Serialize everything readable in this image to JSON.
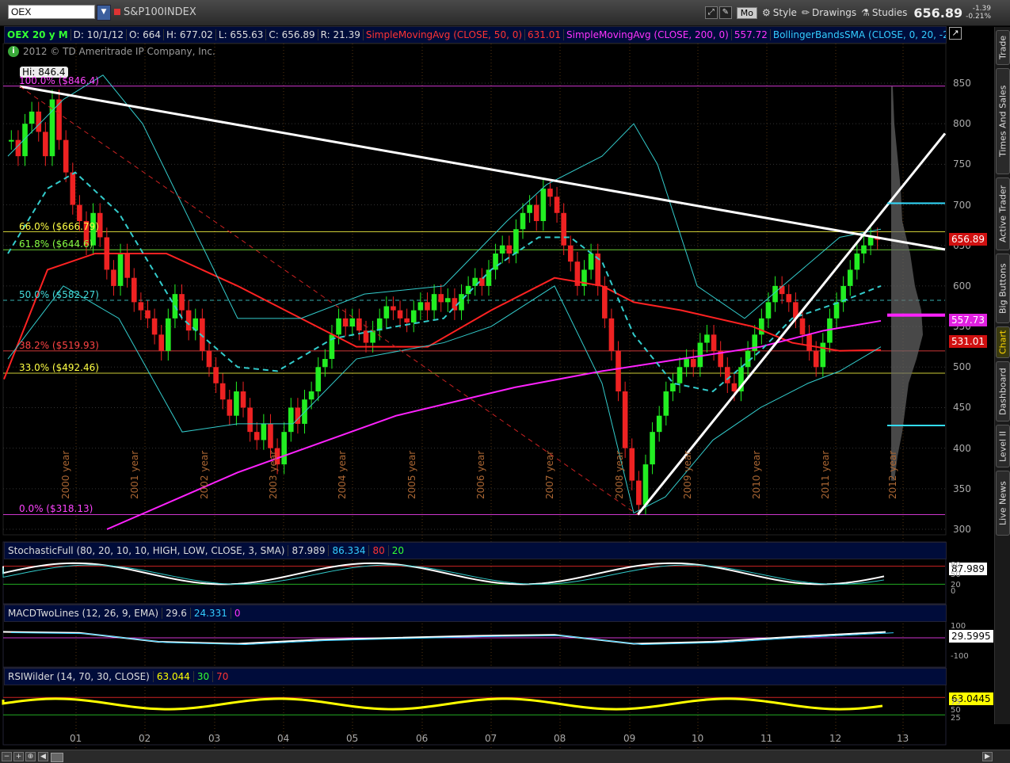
{
  "toolbar": {
    "symbol": "OEX",
    "symbol_name": "S&P100INDEX",
    "mode_label": "Mo",
    "style_label": "Style",
    "drawings_label": "Drawings",
    "studies_label": "Studies",
    "last_price": "656.89",
    "change": "-1.39",
    "change_pct": "-0.21%"
  },
  "legend": {
    "title": "OEX 20 y M",
    "date": "D: 10/1/12",
    "open": "O: 664",
    "high": "H: 677.02",
    "low": "L: 655.63",
    "close": "C: 656.89",
    "range": "R: 21.39",
    "sma50": "SimpleMovingAvg (CLOSE, 50, 0)",
    "sma50_val": "631.01",
    "sma200": "SimpleMovingAvg (CLOSE, 200, 0)",
    "sma200_val": "557.72",
    "bb": "BollingerBandsSMA (CLOSE, 0, 20, -2..."
  },
  "copyright": "2012 © TD Ameritrade IP Company, Inc.",
  "hi_label": "Hi: 846.4",
  "fib_labels": [
    {
      "text": "100.0%  ($846.4)",
      "price": 846.4,
      "color": "#ff44ff"
    },
    {
      "text": "66.0%  ($666.79)",
      "price": 666.79,
      "color": "#ffff44"
    },
    {
      "text": "61.8%  ($644.6)",
      "price": 644.6,
      "color": "#88ff44"
    },
    {
      "text": "50.0%  ($582.27)",
      "price": 582.27,
      "color": "#44dddd"
    },
    {
      "text": "38.2%  ($519.93)",
      "price": 519.93,
      "color": "#ff4444"
    },
    {
      "text": "33.0%  ($492.46)",
      "price": 492.46,
      "color": "#ffff44"
    },
    {
      "text": "0.0%  ($318.13)",
      "price": 318.13,
      "color": "#ff44ff"
    }
  ],
  "price_axis": [
    "850",
    "800",
    "750",
    "700",
    "650",
    "600",
    "550",
    "500",
    "450",
    "400",
    "350",
    "300"
  ],
  "price_tags": {
    "last": "656.89",
    "sma200": "557.73",
    "sma50": "531.01"
  },
  "year_labels": [
    "2000 year",
    "2001 year",
    "2002 year",
    "2003 year",
    "2004 year",
    "2005 year",
    "2006 year",
    "2007 year",
    "2008 year",
    "2009 year",
    "2010 year",
    "2011 year",
    "2012 year"
  ],
  "x_axis": [
    "01",
    "02",
    "03",
    "04",
    "05",
    "06",
    "07",
    "08",
    "09",
    "10",
    "11",
    "12",
    "13"
  ],
  "stochastic": {
    "name": "StochasticFull (80, 20, 10, 10, HIGH, LOW, CLOSE, 3, SMA)",
    "v1": "87.989",
    "v2": "86.334",
    "v3": "80",
    "v4": "20",
    "tag": "87.989",
    "axis": [
      "80",
      "50",
      "20",
      "0"
    ]
  },
  "macd": {
    "name": "MACDTwoLines (12, 26, 9, EMA)",
    "v1": "29.6",
    "v2": "24.331",
    "v3": "0",
    "tag": "29.5995",
    "axis": [
      "100",
      "-100"
    ]
  },
  "rsi": {
    "name": "RSIWilder (14, 70, 30, CLOSE)",
    "v1": "63.044",
    "v2": "30",
    "v3": "70",
    "tag": "63.0445",
    "axis": [
      "75",
      "50",
      "25"
    ]
  },
  "sidebar": [
    "Trade",
    "Times And Sales",
    "Active Trader",
    "Big Buttons",
    "Chart",
    "Dashboard",
    "Level II",
    "Live News"
  ],
  "colors": {
    "up": "#22ee22",
    "down": "#ee2222",
    "sma50": "#ff2222",
    "sma200": "#ff22ff",
    "bb": "#33cccc",
    "rsi": "#ffff00"
  }
}
